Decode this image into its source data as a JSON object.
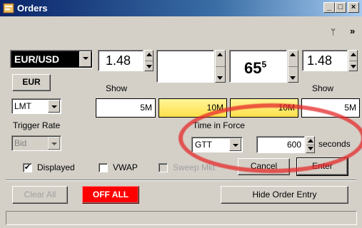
{
  "window": {
    "title": "Orders",
    "minimize": "_",
    "maximize": "□",
    "close": "×"
  },
  "toolbar": {
    "pin_glyph": "ᛘ",
    "more_glyph": "»"
  },
  "order": {
    "pair": "EUR/USD",
    "bid_price": "1.48",
    "price_main": "65",
    "price_sup": "5",
    "ask_price": "1.48",
    "currency_button": "EUR",
    "show_left": "Show",
    "show_right": "Show",
    "order_type": "LMT",
    "amounts": [
      "5M",
      "10M",
      "10M",
      "5M"
    ],
    "trigger_rate_label": "Trigger Rate",
    "trigger_rate_value": "Bid",
    "tif_label": "Time in Force",
    "tif_value": "GTT",
    "seconds_value": "600",
    "seconds_label": "seconds"
  },
  "options": {
    "displayed": "Displayed",
    "displayed_checked": true,
    "vwap": "VWAP",
    "sweep": "Sweep Mkt"
  },
  "actions": {
    "cancel": "Cancel",
    "enter": "Enter",
    "clear_all": "Clear All",
    "off_all": "OFF ALL",
    "hide_order_entry": "Hide Order Entry"
  },
  "colors": {
    "highlight_amount": "#ffee55",
    "off_all_bg": "#ff0000",
    "annotation_ellipse": "#e62828"
  }
}
